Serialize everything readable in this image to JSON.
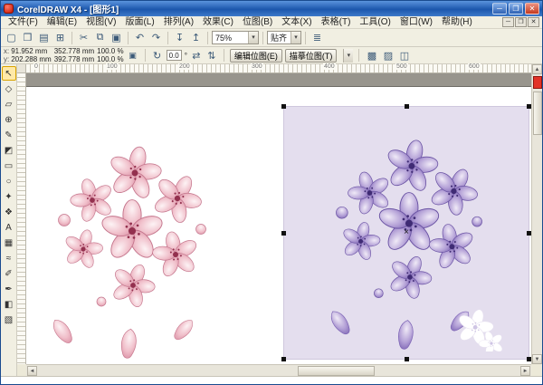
{
  "window": {
    "title": "CorelDRAW X4 - [图形1]",
    "minimize_glyph": "─",
    "maximize_glyph": "❐",
    "close_glyph": "✕"
  },
  "menu": {
    "items": [
      "文件(F)",
      "编辑(E)",
      "视图(V)",
      "版面(L)",
      "排列(A)",
      "效果(C)",
      "位图(B)",
      "文本(X)",
      "表格(T)",
      "工具(O)",
      "窗口(W)",
      "帮助(H)"
    ]
  },
  "mdi": {
    "minimize_glyph": "─",
    "restore_glyph": "❐",
    "close_glyph": "✕"
  },
  "toolbar": {
    "icons": [
      {
        "name": "new-document",
        "glyph": "▢"
      },
      {
        "name": "open",
        "glyph": "❒"
      },
      {
        "name": "save",
        "glyph": "▤"
      },
      {
        "name": "print",
        "glyph": "⊞"
      },
      {
        "name": "cut",
        "glyph": "✂"
      },
      {
        "name": "copy",
        "glyph": "⧉"
      },
      {
        "name": "paste",
        "glyph": "▣"
      },
      {
        "name": "undo",
        "glyph": "↶"
      },
      {
        "name": "redo",
        "glyph": "↷"
      },
      {
        "name": "import",
        "glyph": "↧"
      },
      {
        "name": "export",
        "glyph": "↥"
      }
    ],
    "zoom_value": "75%",
    "snap_label": "贴齐",
    "dropdown_glyph": "▾",
    "options_glyph": "≣"
  },
  "propbar": {
    "pos_x_label": "x:",
    "pos_x": "91.952 mm",
    "pos_y_label": "y:",
    "pos_y": "202.288 mm",
    "size_w": "352.778 mm",
    "size_h": "392.778 mm",
    "scale_x": "100.0",
    "scale_y": "100.0",
    "unit_percent": "%",
    "lock_glyph": "▣",
    "angle_icon_glyph": "↻",
    "angle": "0.0",
    "angle_unit": "°",
    "mirror_h_glyph": "⇄",
    "mirror_v_glyph": "⇅",
    "edit_bitmap_label": "编辑位图(E)",
    "trace_bitmap_label": "描摹位图(T)",
    "extra_icons": [
      {
        "name": "bitmap-resample",
        "glyph": "▩"
      },
      {
        "name": "bitmap-mode",
        "glyph": "▨"
      },
      {
        "name": "bitmap-straighten",
        "glyph": "◫"
      }
    ]
  },
  "toolbox": {
    "tools": [
      {
        "name": "pick-tool",
        "glyph": "↖"
      },
      {
        "name": "shape-tool",
        "glyph": "◇"
      },
      {
        "name": "crop-tool",
        "glyph": "▱"
      },
      {
        "name": "zoom-tool",
        "glyph": "⊕"
      },
      {
        "name": "freehand-tool",
        "glyph": "✎"
      },
      {
        "name": "smart-fill-tool",
        "glyph": "◩"
      },
      {
        "name": "rectangle-tool",
        "glyph": "▭"
      },
      {
        "name": "ellipse-tool",
        "glyph": "○"
      },
      {
        "name": "polygon-tool",
        "glyph": "✦"
      },
      {
        "name": "basic-shapes-tool",
        "glyph": "❖"
      },
      {
        "name": "text-tool",
        "glyph": "A"
      },
      {
        "name": "table-tool",
        "glyph": "▦"
      },
      {
        "name": "blend-tool",
        "glyph": "≈"
      },
      {
        "name": "eyedropper-tool",
        "glyph": "✐"
      },
      {
        "name": "outline-pen-tool",
        "glyph": "✒"
      },
      {
        "name": "fill-tool",
        "glyph": "◧"
      },
      {
        "name": "interactive-fill-tool",
        "glyph": "▧"
      }
    ]
  },
  "ruler": {
    "h_labels": [
      "0",
      "100",
      "200",
      "300",
      "400",
      "500",
      "600"
    ]
  },
  "scrollbars": {
    "up": "▲",
    "down": "▼",
    "left": "◄",
    "right": "►"
  },
  "selection": {
    "center_marker": "×"
  },
  "artwork": {
    "pink_image": {
      "description": "pink cherry blossom cluster with loose petals",
      "petal_light": "#fdf3f5",
      "petal_mid": "#f0bfca",
      "petal_deep": "#d4839a",
      "flower_center": "#93304e",
      "background": "#ffffff"
    },
    "purple_image": {
      "description": "purple recolored blossom cluster, selected",
      "petal_light": "#f0eaf7",
      "petal_mid": "#b3a0d6",
      "petal_deep": "#6f55ab",
      "flower_center": "#3f2b74",
      "background": "#e4deee",
      "selected": true
    },
    "swatch_red": "#e23227"
  }
}
